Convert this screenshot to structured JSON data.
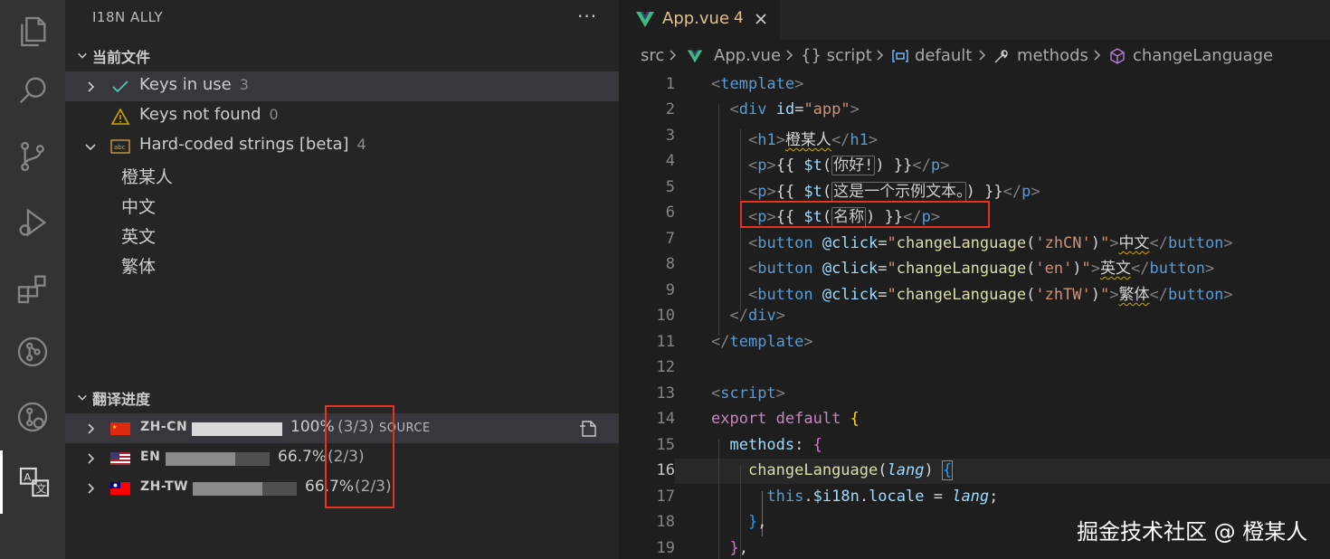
{
  "activity_bar": {
    "items": [
      {
        "icon": "files-icon"
      },
      {
        "icon": "search-icon"
      },
      {
        "icon": "source-control-icon"
      },
      {
        "icon": "run-debug-icon"
      },
      {
        "icon": "extensions-icon"
      },
      {
        "icon": "git-graph-icon"
      },
      {
        "icon": "git-history-icon"
      },
      {
        "icon": "i18n-ally-icon",
        "active": true
      }
    ]
  },
  "sidebar": {
    "title": "I18N ALLY",
    "more": "···",
    "current_file": {
      "header": "当前文件",
      "items": [
        {
          "label": "Keys in use",
          "count": "3"
        },
        {
          "label": "Keys not found",
          "count": "0"
        },
        {
          "label": "Hard-coded strings [beta]",
          "count": "4"
        }
      ],
      "hardcoded": [
        "橙某人",
        "中文",
        "英文",
        "繁体"
      ]
    },
    "progress": {
      "header": "翻译进度",
      "rows": [
        {
          "locale": "ZH-CN",
          "percent_text": "100%",
          "fraction": "(3/3)",
          "tag": "SOURCE",
          "progress": 1.0
        },
        {
          "locale": "EN",
          "percent_text": "66.7%",
          "fraction": "(2/3)",
          "tag": "",
          "progress": 0.667
        },
        {
          "locale": "ZH-TW",
          "percent_text": "66.7%",
          "fraction": "(2/3)",
          "tag": "",
          "progress": 0.667
        }
      ]
    }
  },
  "editor": {
    "tab": {
      "name": "App.vue",
      "problems": "4"
    },
    "breadcrumb": {
      "parts": [
        "src",
        "App.vue",
        "{} script",
        "default",
        "methods",
        "changeLanguage"
      ]
    },
    "current_line": "16",
    "line_numbers": [
      "1",
      "2",
      "3",
      "4",
      "5",
      "6",
      "7",
      "8",
      "9",
      "10",
      "11",
      "12",
      "13",
      "14",
      "15",
      "16",
      "17",
      "18",
      "19"
    ]
  },
  "watermark": "掘金技术社区 @ 橙某人",
  "colors": {
    "activity_bg": "#333333",
    "sidebar_bg": "#252526",
    "editor_bg": "#1e1e1e",
    "highlight_red": "#e8321e",
    "vue_green": "#41b883",
    "warning": "#cca700",
    "check": "#4ec9b0"
  }
}
